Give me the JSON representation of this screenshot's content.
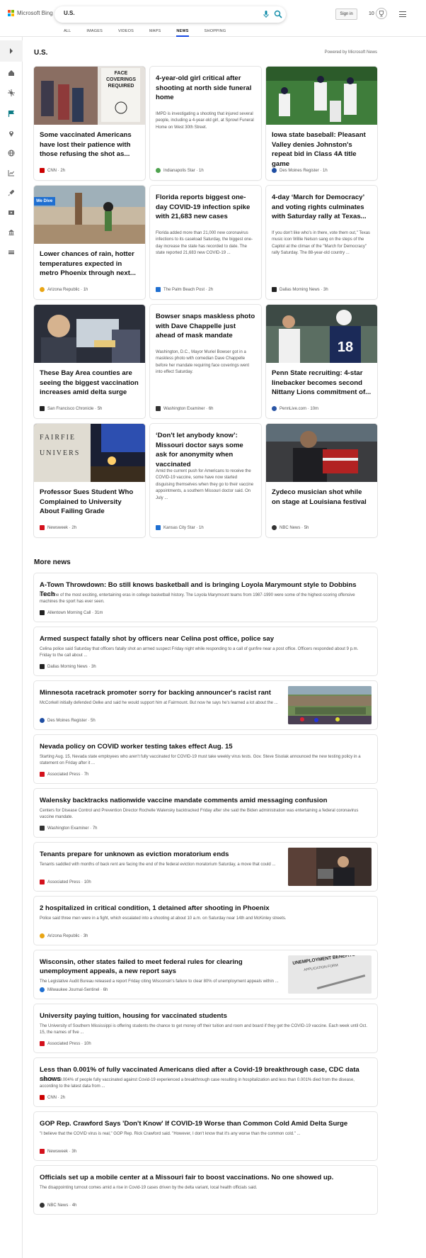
{
  "brand": {
    "name": "Microsoft Bing"
  },
  "search": {
    "value": "U.S."
  },
  "tabs": [
    {
      "label": "ALL"
    },
    {
      "label": "IMAGES"
    },
    {
      "label": "VIDEOS"
    },
    {
      "label": "MAPS"
    },
    {
      "label": "NEWS"
    },
    {
      "label": "SHOPPING"
    }
  ],
  "header": {
    "signin": "Sign in",
    "points": "10"
  },
  "section": {
    "title": "U.S.",
    "powered": "Powered by Microsoft News"
  },
  "cards": [
    {
      "title": "Some vaccinated Americans have lost their patience with those refusing the shot as...",
      "source": "CNN",
      "time": "2h",
      "image": "face-coverings-sign-photo",
      "fav": "#cc0000"
    },
    {
      "title": "4-year-old girl critical after shooting at north side funeral home",
      "snippet": "IMPD is investigating a shooting that injured several people, including a 4-year-old girl, at Sprowl Funeral Home on West 30th Street.",
      "source": "Indianapolis Star",
      "time": "1h",
      "fav": "#4ea34e"
    },
    {
      "title": "Iowa state baseball: Pleasant Valley denies Johnston's repeat bid in Class 4A title game",
      "source": "Des Moines Register",
      "time": "1h",
      "image": "baseball-celebration-photo",
      "fav": "#1f4ea3"
    },
    {
      "title": "Lower chances of rain, hotter temperatures expected in metro Phoenix through next...",
      "source": "Arizona Republic",
      "time": "1h",
      "image": "phoenix-street-photo",
      "badge": "We Dive",
      "fav": "#e9a514"
    },
    {
      "title": "Florida reports biggest one-day COVID-19 infection spike with 21,683 new cases",
      "snippet": "Florida added more than 21,000 new coronavirus infections to its caseload Saturday, the biggest one-day increase the state has recorded to date. The state reported 21,683 new COVID-19 ...",
      "source": "The Palm Beach Post",
      "time": "2h",
      "fav": "#1f6fd1"
    },
    {
      "title": "4-day ‘March for Democracy’ and voting rights culminates with Saturday rally at Texas...",
      "snippet": "If you don't like who's in there, vote them out,\" Texas music icon Willie Nelson sang on the steps of the Capitol at the climax of the \"March for Democracy\" rally Saturday. The 88-year-old country ...",
      "source": "Dallas Morning News",
      "time": "3h",
      "fav": "#222222"
    },
    {
      "title": "These Bay Area counties are seeing the biggest vaccination increases amid delta surge",
      "source": "San Francisco Chronicle",
      "time": "5h",
      "image": "vaccination-photo",
      "fav": "#222222"
    },
    {
      "title": "Bowser snaps maskless photo with Dave Chappelle just ahead of mask mandate",
      "snippet": "Washington, D.C., Mayor Muriel Bowser got in a maskless photo with comedian Dave Chappelle before her mandate requiring face coverings went into effect Saturday.",
      "source": "Washington Examiner",
      "time": "6h",
      "fav": "#333333"
    },
    {
      "title": "Penn State recruiting: 4-star linebacker becomes second Nittany Lions commitment of...",
      "source": "PennLive.com",
      "time": "10m",
      "image": "football-photo",
      "fav": "#2a55a5"
    },
    {
      "title": "Professor Sues Student Who Complained to University About Failing Grade",
      "source": "Newsweek",
      "time": "2h",
      "image": "fairfield-university-sign-photo",
      "fav": "#d4111c"
    },
    {
      "title": "‘Don't let anybody know’: Missouri doctor says some ask for anonymity when vaccinated",
      "snippet": "Amid the current push for Americans to receive the COVID-19 vaccine, some have now started disguising themselves when they go to their vaccine appointments, a southern Missouri doctor said. On July ...",
      "source": "Kansas City Star",
      "time": "1h",
      "fav": "#1f6fd1"
    },
    {
      "title": "Zydeco musician shot while on stage at Louisiana festival",
      "source": "NBC News",
      "time": "5h",
      "image": "accordion-musician-photo",
      "fav": "#333333"
    }
  ],
  "more": {
    "title": "More news"
  },
  "news": [
    {
      "title": "A-Town Throwdown: Bo still knows basketball and is bringing Loyola Marymount style to Dobbins Tech",
      "desc": "It was one of the most exciting, entertaining eras in college basketball history. The Loyola Marymount teams from 1987-1990 were some of the highest-scoring offensive machines the sport has ever seen.",
      "source": "Allentown Morning Call",
      "time": "31m",
      "fav": "#222222"
    },
    {
      "title": "Armed suspect fatally shot by officers near Celina post office, police say",
      "desc": "Celina police said Saturday that officers fatally shot an armed suspect Friday night while responding to a call of gunfire near a post office. Officers responded about 9 p.m. Friday to the call about ...",
      "source": "Dallas Morning News",
      "time": "3h",
      "fav": "#222222"
    },
    {
      "title": "Minnesota racetrack promoter sorry for backing announcer's racist rant",
      "desc": "McCorkell initially defended Oelke and said he would support him at Fairmount. But now he says he's learned a lot about the ...",
      "source": "Des Moines Register",
      "time": "5h",
      "image": "racetrack-photo",
      "fav": "#1f4ea3"
    },
    {
      "title": "Nevada policy on COVID worker testing takes effect Aug. 15",
      "desc": "Starting Aug. 15, Nevada state employees who aren't fully vaccinated for COVID-19 must take weekly virus tests. Gov. Steve Sisolak announced the new testing policy in a statement on Friday after it ...",
      "source": "Associated Press",
      "time": "7h",
      "fav": "#d4111c"
    },
    {
      "title": "Walensky backtracks nationwide vaccine mandate comments amid messaging confusion",
      "desc": "Centers for Disease Control and Prevention Director Rochelle Walensky backtracked Friday after she said the Biden administration was entertaining a federal coronavirus vaccine mandate.",
      "source": "Washington Examiner",
      "time": "7h",
      "fav": "#333333"
    },
    {
      "title": "Tenants prepare for unknown as eviction moratorium ends",
      "desc": "Tenants saddled with months of back rent are facing the end of the federal eviction moratorium Saturday, a move that could ...",
      "source": "Associated Press",
      "time": "10h",
      "image": "tenant-photo",
      "fav": "#d4111c"
    },
    {
      "title": "2 hospitalized in critical condition, 1 detained after shooting in Phoenix",
      "desc": "Police said three men were in a fight, which escalated into a shooting at about 10 a.m. on Saturday near 14th and McKinley streets.",
      "source": "Arizona Republic",
      "time": "3h",
      "fav": "#e9a514"
    },
    {
      "title": "Wisconsin, other states failed to meet federal rules for clearing unemployment appeals, a new report says",
      "desc": "The Legislative Audit Bureau released a report Friday citing Wisconsin's failure to clear 80% of unemployment appeals within ...",
      "source": "Milwaukee Journal-Sentinel",
      "time": "6h",
      "image": "unemployment-form-photo",
      "imageText": "UNEMPLOYMENT BENEFITS",
      "imageText2": "APPLICATION FORM",
      "fav": "#1f6fd1"
    },
    {
      "title": "University paying tuition, housing for vaccinated students",
      "desc": "The University of Southern Mississippi is offering students the chance to get money off their tuition and room and board if they get the COVID-19 vaccine. Each week until Oct. 15, the names of five ...",
      "source": "Associated Press",
      "time": "10h",
      "fav": "#d4111c"
    },
    {
      "title": "Less than 0.001% of fully vaccinated Americans died after a Covid-19 breakthrough case, CDC data shows",
      "desc": "Less than 0.004% of people fully vaccinated against Covid-19 experienced a breakthrough case resulting in hospitalization and less than 0.001% died from the disease, according to the latest data from ...",
      "source": "CNN",
      "time": "2h",
      "fav": "#cc0000"
    },
    {
      "title": "GOP Rep. Crawford Says 'Don't Know' If COVID-19 Worse than Common Cold Amid Delta Surge",
      "desc": "\"I believe that the COVID virus is real,\" GOP Rep. Rick Crawford said. \"However, I don't know that it's any worse than the common cold.\" ...",
      "source": "Newsweek",
      "time": "3h",
      "fav": "#d4111c"
    },
    {
      "title": "Officials set up a mobile center at a Missouri fair to boost vaccinations. No one showed up.",
      "desc": "The disappointing turnout comes amid a rise in Covid-19 cases driven by the delta variant, local health officials said.",
      "source": "NBC News",
      "time": "4h",
      "fav": "#333333"
    }
  ],
  "colors": {
    "accent": "#174ae4",
    "searchIcon": "#0e8ba8"
  }
}
